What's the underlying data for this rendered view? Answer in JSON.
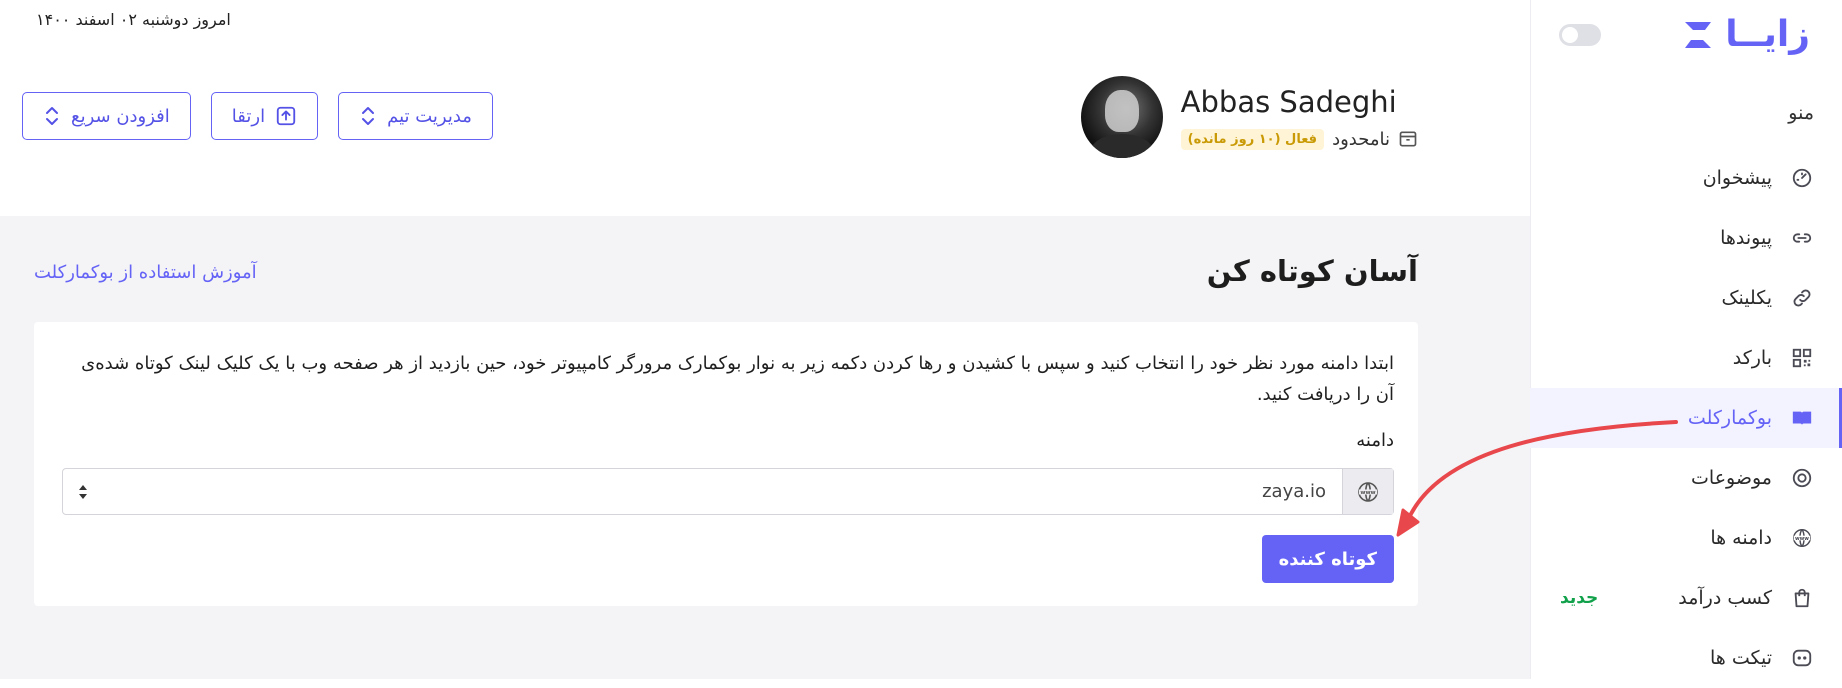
{
  "date": "امروز دوشنبه ۰۲ اسفند ۱۴۰۰",
  "brand": {
    "name": "زایــا"
  },
  "sidebar": {
    "menu_title": "منو",
    "items": [
      {
        "label": "پیشخوان",
        "icon": "dashboard-gauge-icon"
      },
      {
        "label": "پیوندها",
        "icon": "link-icon"
      },
      {
        "label": "یکلینک",
        "icon": "chain-link-icon"
      },
      {
        "label": "بارکد",
        "icon": "qr-code-icon"
      },
      {
        "label": "بوکمارکلت",
        "icon": "book-icon",
        "active": true
      },
      {
        "label": "موضوعات",
        "icon": "target-icon"
      },
      {
        "label": "دامنه ها",
        "icon": "www-globe-icon"
      },
      {
        "label": "کسب درآمد",
        "icon": "shopping-bag-icon",
        "badge": "جدید"
      },
      {
        "label": "تیکت ها",
        "icon": "chat-ticket-icon"
      }
    ]
  },
  "profile": {
    "name": "Abbas Sadeghi",
    "plan": "نامحدود",
    "status": "فعال (۱۰ روز مانده)"
  },
  "actions": {
    "team": "مدیریت تیم",
    "upgrade": "ارتقا",
    "quick_add": "افزودن سریع"
  },
  "page": {
    "title": "آسان کوتاه کن",
    "help_link": "آموزش استفاده از بوکمارکلت",
    "description": "ابتدا دامنه مورد نظر خود را انتخاب کنید و سپس با کشیدن و رها کردن دکمه زیر به نوار بوکمارک مرورگر کامپیوتر خود، حین بازدید از هر صفحه وب با یک کلیک لینک کوتاه شده‌ی آن را دریافت کنید.",
    "domain_label": "دامنه",
    "domain_value": "zaya.io",
    "shorten_button": "کوتاه کننده"
  },
  "colors": {
    "accent": "#6563f6",
    "new_badge": "#12a14b",
    "status_badge_bg": "#fff4d6",
    "status_badge_text": "#c99a05",
    "annotation_arrow": "#e8484c"
  }
}
